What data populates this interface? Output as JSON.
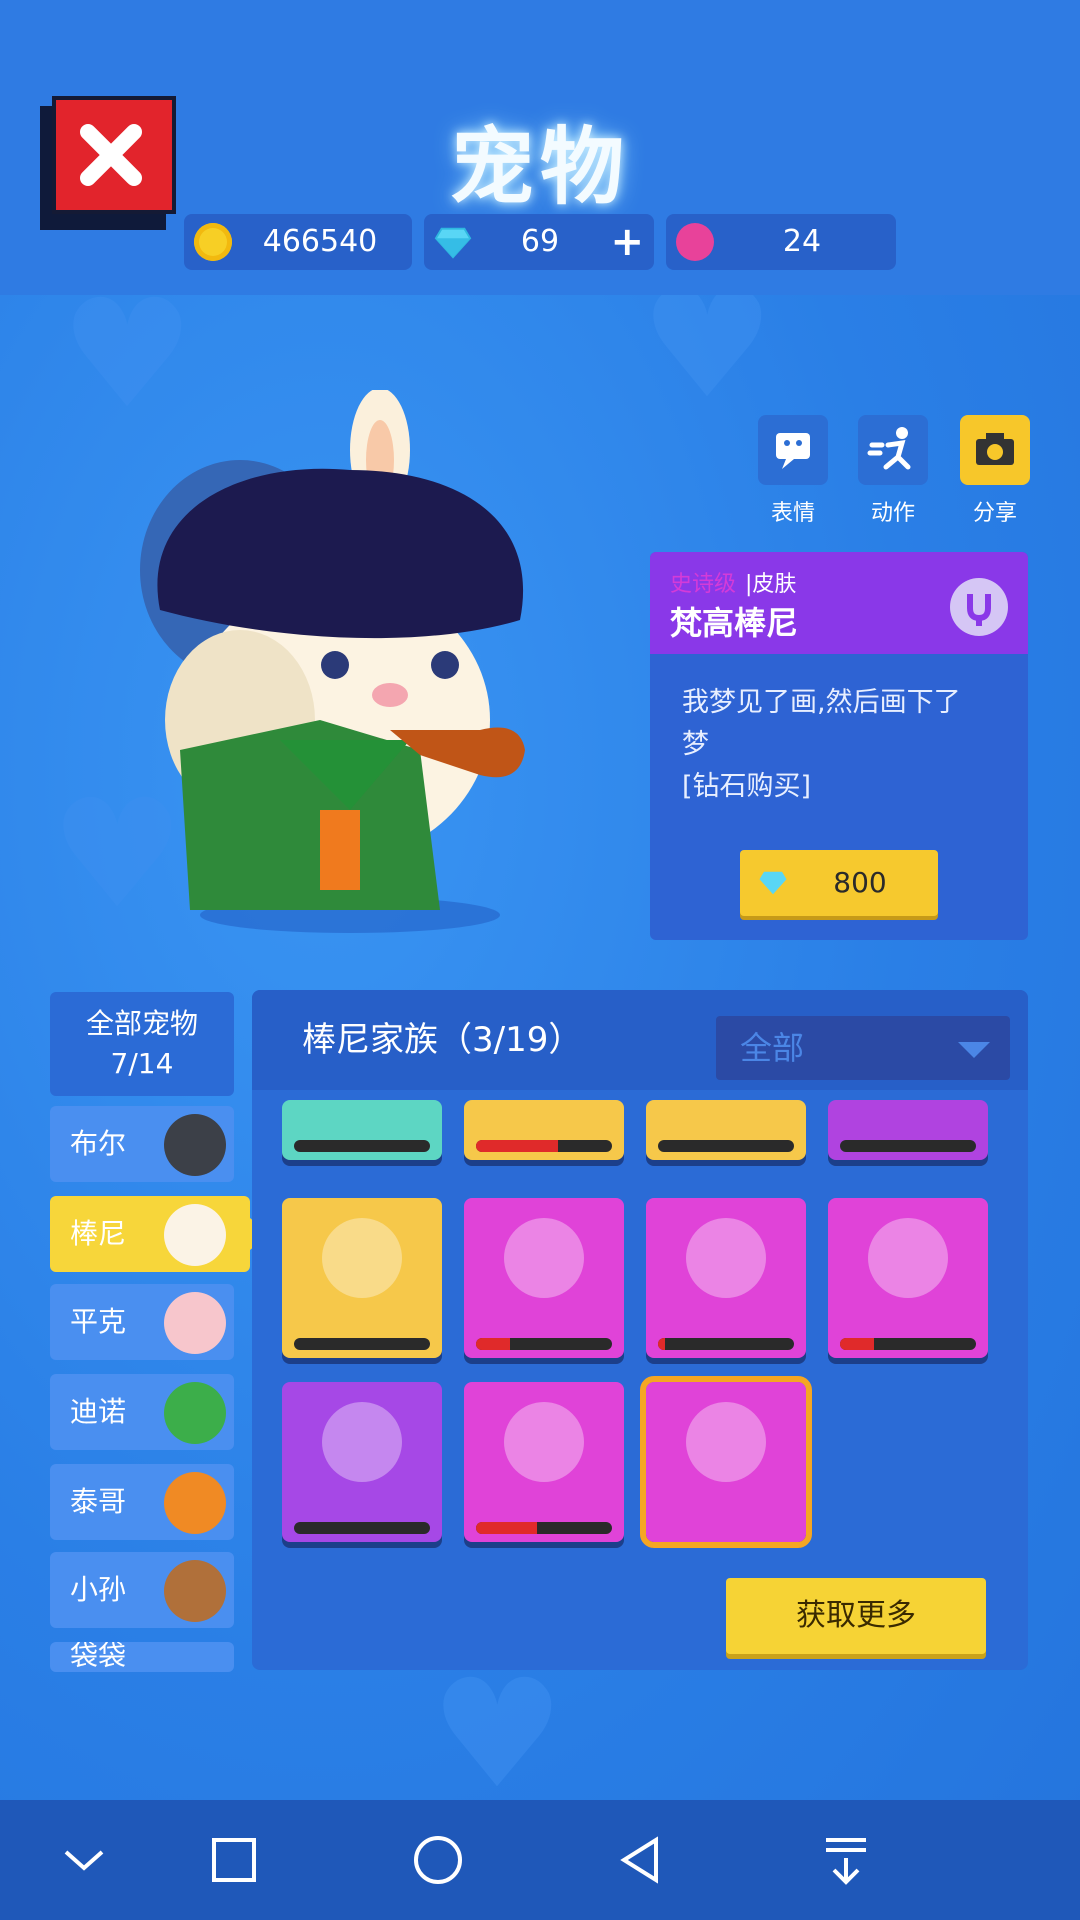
{
  "header": {
    "title": "宠物"
  },
  "currency": {
    "coins": "466540",
    "diamonds": "69",
    "tickets": "24",
    "add_symbol": "+"
  },
  "actions": {
    "emote": "表情",
    "motion": "动作",
    "share": "分享"
  },
  "skin": {
    "rarity": "史诗级",
    "type": "皮肤",
    "name": "梵高棒尼",
    "description_line1": "我梦见了画,然后画下了",
    "description_line2": "梦",
    "description_line3": "[钻石购买]",
    "price": "800"
  },
  "sidebar": {
    "all_label": "全部宠物",
    "all_count": "7/14",
    "items": [
      {
        "label": "布尔"
      },
      {
        "label": "棒尼"
      },
      {
        "label": "平克"
      },
      {
        "label": "迪诺"
      },
      {
        "label": "泰哥"
      },
      {
        "label": "小孙"
      },
      {
        "label": "袋袋"
      }
    ]
  },
  "panel": {
    "family_title": "棒尼家族（3/19）",
    "filter_value": "全部",
    "more_button": "获取更多",
    "skins_progress": [
      0,
      0.6,
      0,
      0,
      0,
      0.25,
      0.05,
      0.25,
      0,
      0.45,
      0
    ]
  },
  "colors": {
    "accent_yellow": "#f6c92e",
    "epic_purple": "#8a38e8",
    "bg_blue": "#2a7fe6"
  },
  "navbar": {
    "icons": [
      "chevron-down-icon",
      "square-icon",
      "circle-icon",
      "back-triangle-icon",
      "download-icon"
    ]
  }
}
